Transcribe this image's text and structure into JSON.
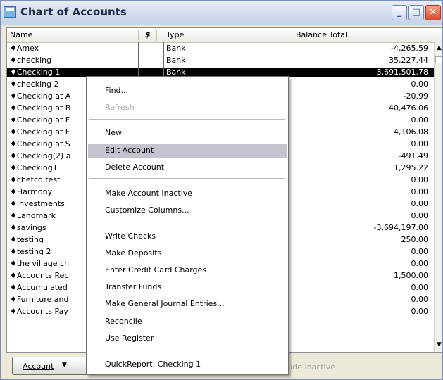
{
  "window": {
    "title": "Chart of Accounts"
  },
  "columns": {
    "name": "Name",
    "flag_icon": "$",
    "type": "Type",
    "balance": "Balance Total"
  },
  "rows": [
    {
      "name": "♦Amex",
      "type": "Bank",
      "balance": "-4,265.59"
    },
    {
      "name": "♦checking",
      "type": "Bank",
      "balance": "35,227.44"
    },
    {
      "name": "♦Checking 1",
      "type": "Bank",
      "balance": "3,691,501.78"
    },
    {
      "name": "♦checking 2",
      "type": "",
      "balance": "0.00"
    },
    {
      "name": "♦Checking at A",
      "type": "",
      "balance": "-20.99"
    },
    {
      "name": "♦Checking at B",
      "type": "",
      "balance": "40,476.06"
    },
    {
      "name": "♦Checking at F",
      "type": "",
      "balance": "0.00"
    },
    {
      "name": "♦Checking at F",
      "type": "",
      "balance": "4,106.08"
    },
    {
      "name": "♦Checking at S",
      "type": "",
      "balance": "0.00"
    },
    {
      "name": "♦Checking(2) a",
      "type": "",
      "balance": "-491.49"
    },
    {
      "name": "♦Checking1",
      "type": "",
      "balance": "1,295.22"
    },
    {
      "name": "♦chetco test",
      "type": "",
      "balance": "0.00"
    },
    {
      "name": "♦Harmony",
      "type": "",
      "balance": "0.00"
    },
    {
      "name": "♦Investments",
      "type": "",
      "balance": "0.00"
    },
    {
      "name": "♦Landmark",
      "type": "",
      "balance": "0.00"
    },
    {
      "name": "♦savings",
      "type": "",
      "balance": "-3,694,197.00"
    },
    {
      "name": "♦testing",
      "type": "",
      "balance": "250.00"
    },
    {
      "name": "♦testing 2",
      "type": "",
      "balance": "0.00"
    },
    {
      "name": "♦the village ch",
      "type": "",
      "balance": "0.00"
    },
    {
      "name": "♦Accounts Rec",
      "type": "",
      "balance": "1,500.00"
    },
    {
      "name": "♦Accumulated",
      "type": "",
      "balance": "0.00"
    },
    {
      "name": "♦Furniture and",
      "type": "",
      "balance": "0.00"
    },
    {
      "name": "♦Accounts Pay",
      "type": "",
      "balance": "0.00"
    }
  ],
  "selected_row": "♦Checking 1",
  "menu": {
    "items": [
      {
        "label": "Find...",
        "enabled": true
      },
      {
        "label": "Refresh",
        "enabled": false
      },
      {
        "label": "New",
        "enabled": true
      },
      {
        "label": "Edit Account",
        "enabled": true,
        "highlighted": true
      },
      {
        "label": "Delete Account",
        "enabled": true
      },
      {
        "label": "Make Account Inactive",
        "enabled": true
      },
      {
        "label": "Customize Columns...",
        "enabled": true
      },
      {
        "label": "Write Checks",
        "enabled": true
      },
      {
        "label": "Make Deposits",
        "enabled": true
      },
      {
        "label": "Enter Credit Card Charges",
        "enabled": true
      },
      {
        "label": "Transfer Funds",
        "enabled": true
      },
      {
        "label": "Make General Journal Entries...",
        "enabled": true
      },
      {
        "label": "Reconcile",
        "enabled": true
      },
      {
        "label": "Use Register",
        "enabled": true
      },
      {
        "label": "QuickReport: Checking 1",
        "enabled": true
      }
    ]
  },
  "footer": {
    "account_button": "Account",
    "include_inactive": "Include inactive"
  },
  "colors": {
    "selection": "#000000",
    "menu_highlight": "#c5c4ce",
    "close_button": "#d84b25"
  }
}
